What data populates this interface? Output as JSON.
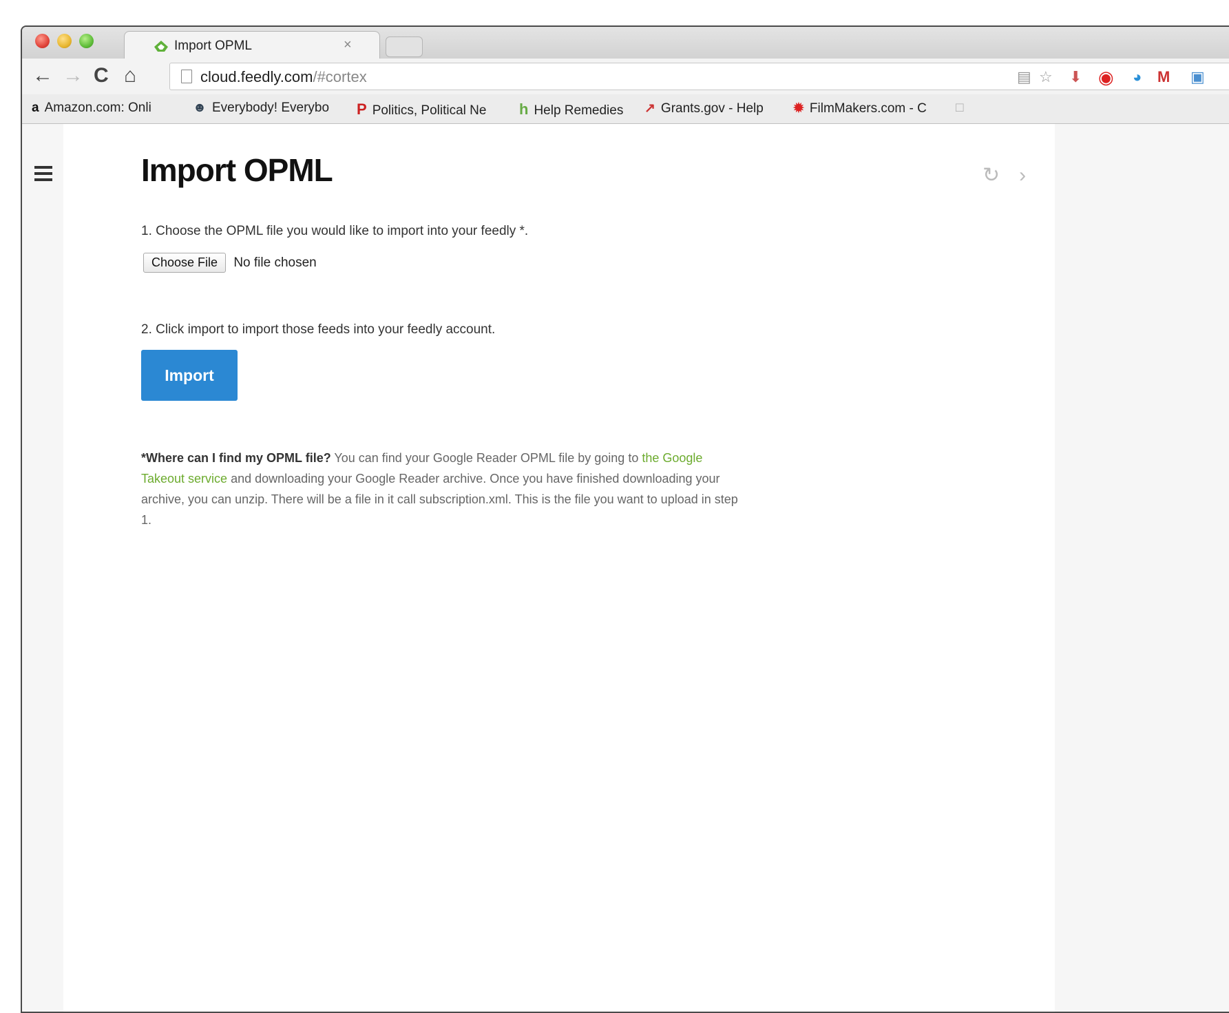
{
  "browser": {
    "tab": {
      "title": "Import OPML",
      "close": "×"
    },
    "url": {
      "host": "cloud.feedly.com",
      "path": "/#cortex"
    },
    "bookmarks": [
      {
        "icon": "a",
        "label": "Amazon.com: Onli"
      },
      {
        "icon": "icon-people",
        "label": "Everybody! Everybo"
      },
      {
        "icon": "P",
        "label": "Politics, Political Ne"
      },
      {
        "icon": "h",
        "label": "Help Remedies"
      },
      {
        "icon": "icon-graph",
        "label": "Grants.gov - Help"
      },
      {
        "icon": "icon-film",
        "label": "FilmMakers.com - C"
      }
    ]
  },
  "page": {
    "title": "Import OPML",
    "step1": "1. Choose the OPML file you would like to import into your feedly *.",
    "choose_file_label": "Choose File",
    "no_file_text": "No file chosen",
    "step2": "2. Click import to import those feeds into your feedly account.",
    "import_label": "Import",
    "help_question": "*Where can I find my OPML file?",
    "help_text_1": " You can find your Google Reader OPML file by going to ",
    "help_link": "the Google Takeout service",
    "help_text_2": " and downloading your Google Reader archive. Once you have finished downloading your archive, you can unzip. There will be a file in it call subscription.xml. This is the file you want to upload in step 1."
  },
  "colors": {
    "accent": "#2b88d3",
    "link": "#6cab2e"
  }
}
